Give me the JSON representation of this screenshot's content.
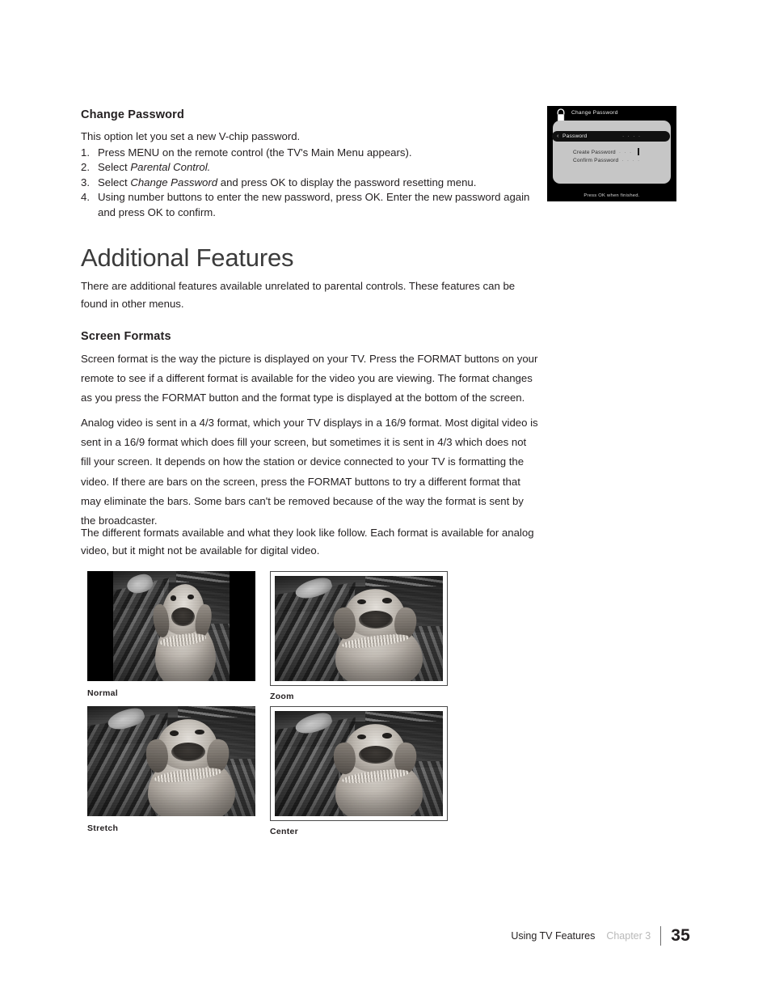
{
  "change_password": {
    "heading": "Change Password",
    "lead": "This option let you set a new V-chip password.",
    "steps": [
      {
        "num": "1.",
        "pre": "Press MENU on the remote control (the TV's Main Menu appears).",
        "italic": "",
        "post": ""
      },
      {
        "num": "2.",
        "pre": "Select ",
        "italic": "Parental Control.",
        "post": ""
      },
      {
        "num": "3.",
        "pre": "Select ",
        "italic": "Change Password",
        "post": " and press OK to display the password resetting menu."
      },
      {
        "num": "4.",
        "pre": "Using number buttons to enter the new password, press OK. Enter the new password again and press OK to confirm.",
        "italic": "",
        "post": ""
      }
    ]
  },
  "tv_menu": {
    "icon": "padlock-icon",
    "title": "Change Password",
    "selected_row": {
      "arrow": "‹",
      "label": "Password",
      "dots": "· · · ·"
    },
    "fields": [
      {
        "label": "Create Password",
        "dots": "· · ·"
      },
      {
        "label": "Confirm Password",
        "dots": "· · · ·"
      }
    ],
    "footer": "Press OK when finished."
  },
  "additional_features": {
    "title": "Additional Features",
    "body": "There are additional features available unrelated to parental controls. These features can be found in other menus."
  },
  "screen_formats": {
    "heading": "Screen Formats",
    "paragraph_1": "Screen format is the way the picture is displayed on your TV. Press the FORMAT buttons on your remote to see if a different format is available for the video you are viewing. The format changes as you press the FORMAT button and the format type is displayed at the bottom of the screen.",
    "paragraph_2": "Analog video is sent in a 4/3 format, which your TV displays in a 16/9 format. Most digital video is sent in a 16/9 format which does fill your screen, but sometimes it is sent in 4/3 which does not fill your screen. It depends on how the station or device connected to your TV is formatting the video. If there are bars on the screen, press the FORMAT buttons to try a different format that may eliminate the bars. Some bars can't be removed because of the way the format is sent by the broadcaster.",
    "paragraph_3": "The different formats available and what they look like follow. Each format is available for analog video, but it might not be available for digital video.",
    "samples": [
      {
        "label": "Normal",
        "style": "pillarbox"
      },
      {
        "label": "Zoom",
        "style": "bordered"
      },
      {
        "label": "Stretch",
        "style": "full"
      },
      {
        "label": "Center",
        "style": "bordered"
      }
    ]
  },
  "footer": {
    "section": "Using TV Features",
    "chapter": "Chapter 3",
    "page": "35"
  },
  "colors": {
    "text": "#231f20",
    "muted": "#b9b9b9",
    "title": "#3b3b3b",
    "menu_bg": "#000000",
    "menu_panel": "#c6c6c6"
  }
}
